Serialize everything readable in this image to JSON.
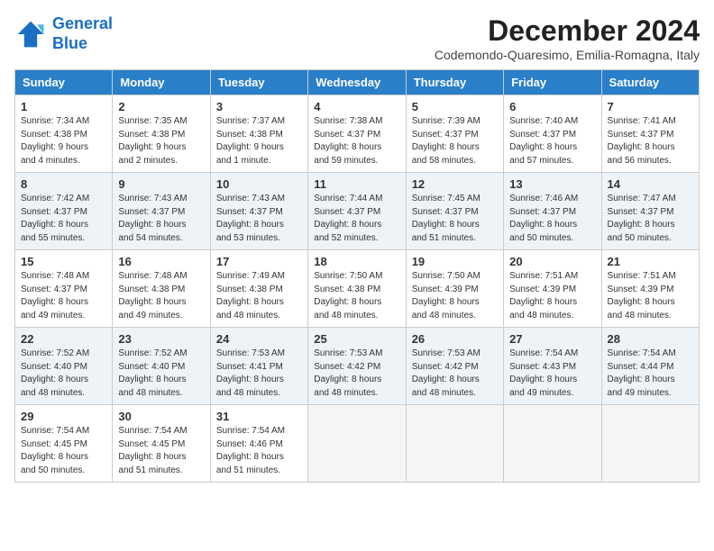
{
  "header": {
    "logo_line1": "General",
    "logo_line2": "Blue",
    "title": "December 2024",
    "subtitle": "Codemondo-Quaresimo, Emilia-Romagna, Italy"
  },
  "columns": [
    "Sunday",
    "Monday",
    "Tuesday",
    "Wednesday",
    "Thursday",
    "Friday",
    "Saturday"
  ],
  "weeks": [
    [
      {
        "day": "1",
        "info": "Sunrise: 7:34 AM\nSunset: 4:38 PM\nDaylight: 9 hours\nand 4 minutes."
      },
      {
        "day": "2",
        "info": "Sunrise: 7:35 AM\nSunset: 4:38 PM\nDaylight: 9 hours\nand 2 minutes."
      },
      {
        "day": "3",
        "info": "Sunrise: 7:37 AM\nSunset: 4:38 PM\nDaylight: 9 hours\nand 1 minute."
      },
      {
        "day": "4",
        "info": "Sunrise: 7:38 AM\nSunset: 4:37 PM\nDaylight: 8 hours\nand 59 minutes."
      },
      {
        "day": "5",
        "info": "Sunrise: 7:39 AM\nSunset: 4:37 PM\nDaylight: 8 hours\nand 58 minutes."
      },
      {
        "day": "6",
        "info": "Sunrise: 7:40 AM\nSunset: 4:37 PM\nDaylight: 8 hours\nand 57 minutes."
      },
      {
        "day": "7",
        "info": "Sunrise: 7:41 AM\nSunset: 4:37 PM\nDaylight: 8 hours\nand 56 minutes."
      }
    ],
    [
      {
        "day": "8",
        "info": "Sunrise: 7:42 AM\nSunset: 4:37 PM\nDaylight: 8 hours\nand 55 minutes."
      },
      {
        "day": "9",
        "info": "Sunrise: 7:43 AM\nSunset: 4:37 PM\nDaylight: 8 hours\nand 54 minutes."
      },
      {
        "day": "10",
        "info": "Sunrise: 7:43 AM\nSunset: 4:37 PM\nDaylight: 8 hours\nand 53 minutes."
      },
      {
        "day": "11",
        "info": "Sunrise: 7:44 AM\nSunset: 4:37 PM\nDaylight: 8 hours\nand 52 minutes."
      },
      {
        "day": "12",
        "info": "Sunrise: 7:45 AM\nSunset: 4:37 PM\nDaylight: 8 hours\nand 51 minutes."
      },
      {
        "day": "13",
        "info": "Sunrise: 7:46 AM\nSunset: 4:37 PM\nDaylight: 8 hours\nand 50 minutes."
      },
      {
        "day": "14",
        "info": "Sunrise: 7:47 AM\nSunset: 4:37 PM\nDaylight: 8 hours\nand 50 minutes."
      }
    ],
    [
      {
        "day": "15",
        "info": "Sunrise: 7:48 AM\nSunset: 4:37 PM\nDaylight: 8 hours\nand 49 minutes."
      },
      {
        "day": "16",
        "info": "Sunrise: 7:48 AM\nSunset: 4:38 PM\nDaylight: 8 hours\nand 49 minutes."
      },
      {
        "day": "17",
        "info": "Sunrise: 7:49 AM\nSunset: 4:38 PM\nDaylight: 8 hours\nand 48 minutes."
      },
      {
        "day": "18",
        "info": "Sunrise: 7:50 AM\nSunset: 4:38 PM\nDaylight: 8 hours\nand 48 minutes."
      },
      {
        "day": "19",
        "info": "Sunrise: 7:50 AM\nSunset: 4:39 PM\nDaylight: 8 hours\nand 48 minutes."
      },
      {
        "day": "20",
        "info": "Sunrise: 7:51 AM\nSunset: 4:39 PM\nDaylight: 8 hours\nand 48 minutes."
      },
      {
        "day": "21",
        "info": "Sunrise: 7:51 AM\nSunset: 4:39 PM\nDaylight: 8 hours\nand 48 minutes."
      }
    ],
    [
      {
        "day": "22",
        "info": "Sunrise: 7:52 AM\nSunset: 4:40 PM\nDaylight: 8 hours\nand 48 minutes."
      },
      {
        "day": "23",
        "info": "Sunrise: 7:52 AM\nSunset: 4:40 PM\nDaylight: 8 hours\nand 48 minutes."
      },
      {
        "day": "24",
        "info": "Sunrise: 7:53 AM\nSunset: 4:41 PM\nDaylight: 8 hours\nand 48 minutes."
      },
      {
        "day": "25",
        "info": "Sunrise: 7:53 AM\nSunset: 4:42 PM\nDaylight: 8 hours\nand 48 minutes."
      },
      {
        "day": "26",
        "info": "Sunrise: 7:53 AM\nSunset: 4:42 PM\nDaylight: 8 hours\nand 48 minutes."
      },
      {
        "day": "27",
        "info": "Sunrise: 7:54 AM\nSunset: 4:43 PM\nDaylight: 8 hours\nand 49 minutes."
      },
      {
        "day": "28",
        "info": "Sunrise: 7:54 AM\nSunset: 4:44 PM\nDaylight: 8 hours\nand 49 minutes."
      }
    ],
    [
      {
        "day": "29",
        "info": "Sunrise: 7:54 AM\nSunset: 4:45 PM\nDaylight: 8 hours\nand 50 minutes."
      },
      {
        "day": "30",
        "info": "Sunrise: 7:54 AM\nSunset: 4:45 PM\nDaylight: 8 hours\nand 51 minutes."
      },
      {
        "day": "31",
        "info": "Sunrise: 7:54 AM\nSunset: 4:46 PM\nDaylight: 8 hours\nand 51 minutes."
      },
      null,
      null,
      null,
      null
    ]
  ]
}
